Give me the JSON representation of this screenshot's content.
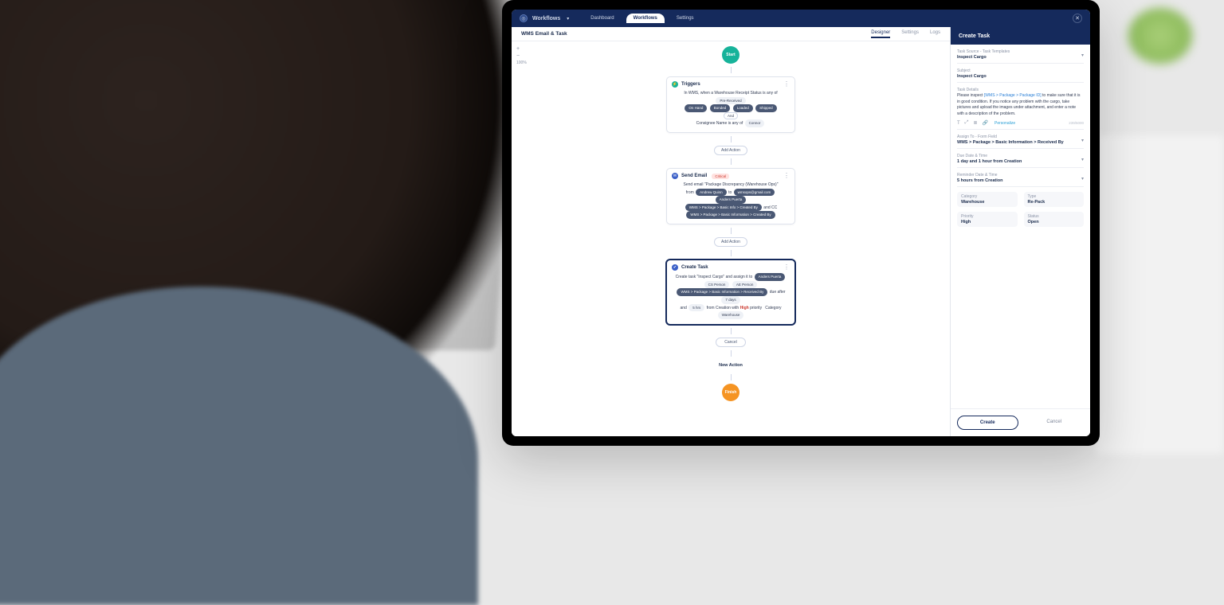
{
  "topbar": {
    "brand": "Workflows",
    "tabs": [
      "Dashboard",
      "Workflows",
      "Settings"
    ],
    "active_tab": "Workflows"
  },
  "subheader": {
    "title": "WMS Email & Task",
    "tabs": [
      "Designer",
      "Settings",
      "Logs"
    ],
    "active": "Designer"
  },
  "zoom": {
    "plus": "+",
    "minus": "−",
    "level": "100%"
  },
  "nodes": {
    "start": "Start",
    "triggers": {
      "title": "Triggers",
      "line1_pre": "In WMS, when a Warehouse Receipt Status is any of",
      "chips1": [
        "Pre-Received",
        "On Hand",
        "Bonded",
        "Loaded",
        "Shipped"
      ],
      "and": "And",
      "line2_pre": "Consignee Name is any of",
      "chips2": [
        "Connor"
      ]
    },
    "add_action": "Add Action",
    "send_email": {
      "title": "Send Email",
      "badge": "Critical",
      "line1": "Send email \"Package Discrepancy (Warehouse Ops)\"",
      "from_lbl": "from",
      "from_chip": "Andrew Quinn",
      "to_lbl": "to",
      "to_chips": [
        "wmsops@gmail.com",
        "Anders Puerta"
      ],
      "line3_chip": "WMS > Package > Basic Info > Created By",
      "line3_cc": "and CC",
      "line4_chip": "WMS > Package > Basic Information > Created By"
    },
    "create_task": {
      "title": "Create Task",
      "line1a": "Create task \"Inspect Cargo\" and assign it to",
      "assignee": "Anders Puerta",
      "chips_row": [
        "CS Person",
        "AE Person"
      ],
      "path_chip": "WMS > Package > Basic Information > Received By",
      "due_pre": "due after",
      "due_chip": "7 days",
      "and": "and",
      "rem_chip": "5 hrs",
      "rem_post": "from Creation with",
      "priority": "High",
      "priority_post": "priority",
      "cat_lbl": "Category",
      "cat_chip": "Warehouse"
    },
    "cancel_inline": "Cancel",
    "new_action": "New Action",
    "finish": "Finish"
  },
  "panel": {
    "title": "Create Task",
    "task_source_lbl": "Task Source - Task Templates",
    "task_source_val": "Inspect Cargo",
    "subject_lbl": "Subject",
    "subject_val": "Inspect Cargo",
    "details_lbl": "Task Details",
    "details_pre": "Please inspect ",
    "details_link": "[WMS > Package > Package ID]",
    "details_post": " to make sure that it is in good condition. If you notice any problem with the cargo, take pictures and upload the images under attachment, and enter a note with a description of the problem.",
    "personalize": "Personalize",
    "charcount": "239/5000",
    "assign_lbl": "Assign To - Form Field",
    "assign_val": "WMS > Package > Basic Information >  Received By",
    "due_lbl": "Due Date & Time",
    "due_val_a": "1 day",
    "due_val_b": " and ",
    "due_val_c": "1 hour",
    "due_val_d": " from Creation",
    "reminder_lbl": "Reminder Date & Time",
    "reminder_val_a": "5 hours",
    "reminder_val_b": " from Creation",
    "category_lbl": "Category",
    "category_val": "Warehouse",
    "type_lbl": "Type",
    "type_val": "Re-Pack",
    "priority_lbl": "Priority",
    "priority_val": "High",
    "status_lbl": "Status",
    "status_val": "Open",
    "create_btn": "Create",
    "cancel_btn": "Cancel"
  }
}
